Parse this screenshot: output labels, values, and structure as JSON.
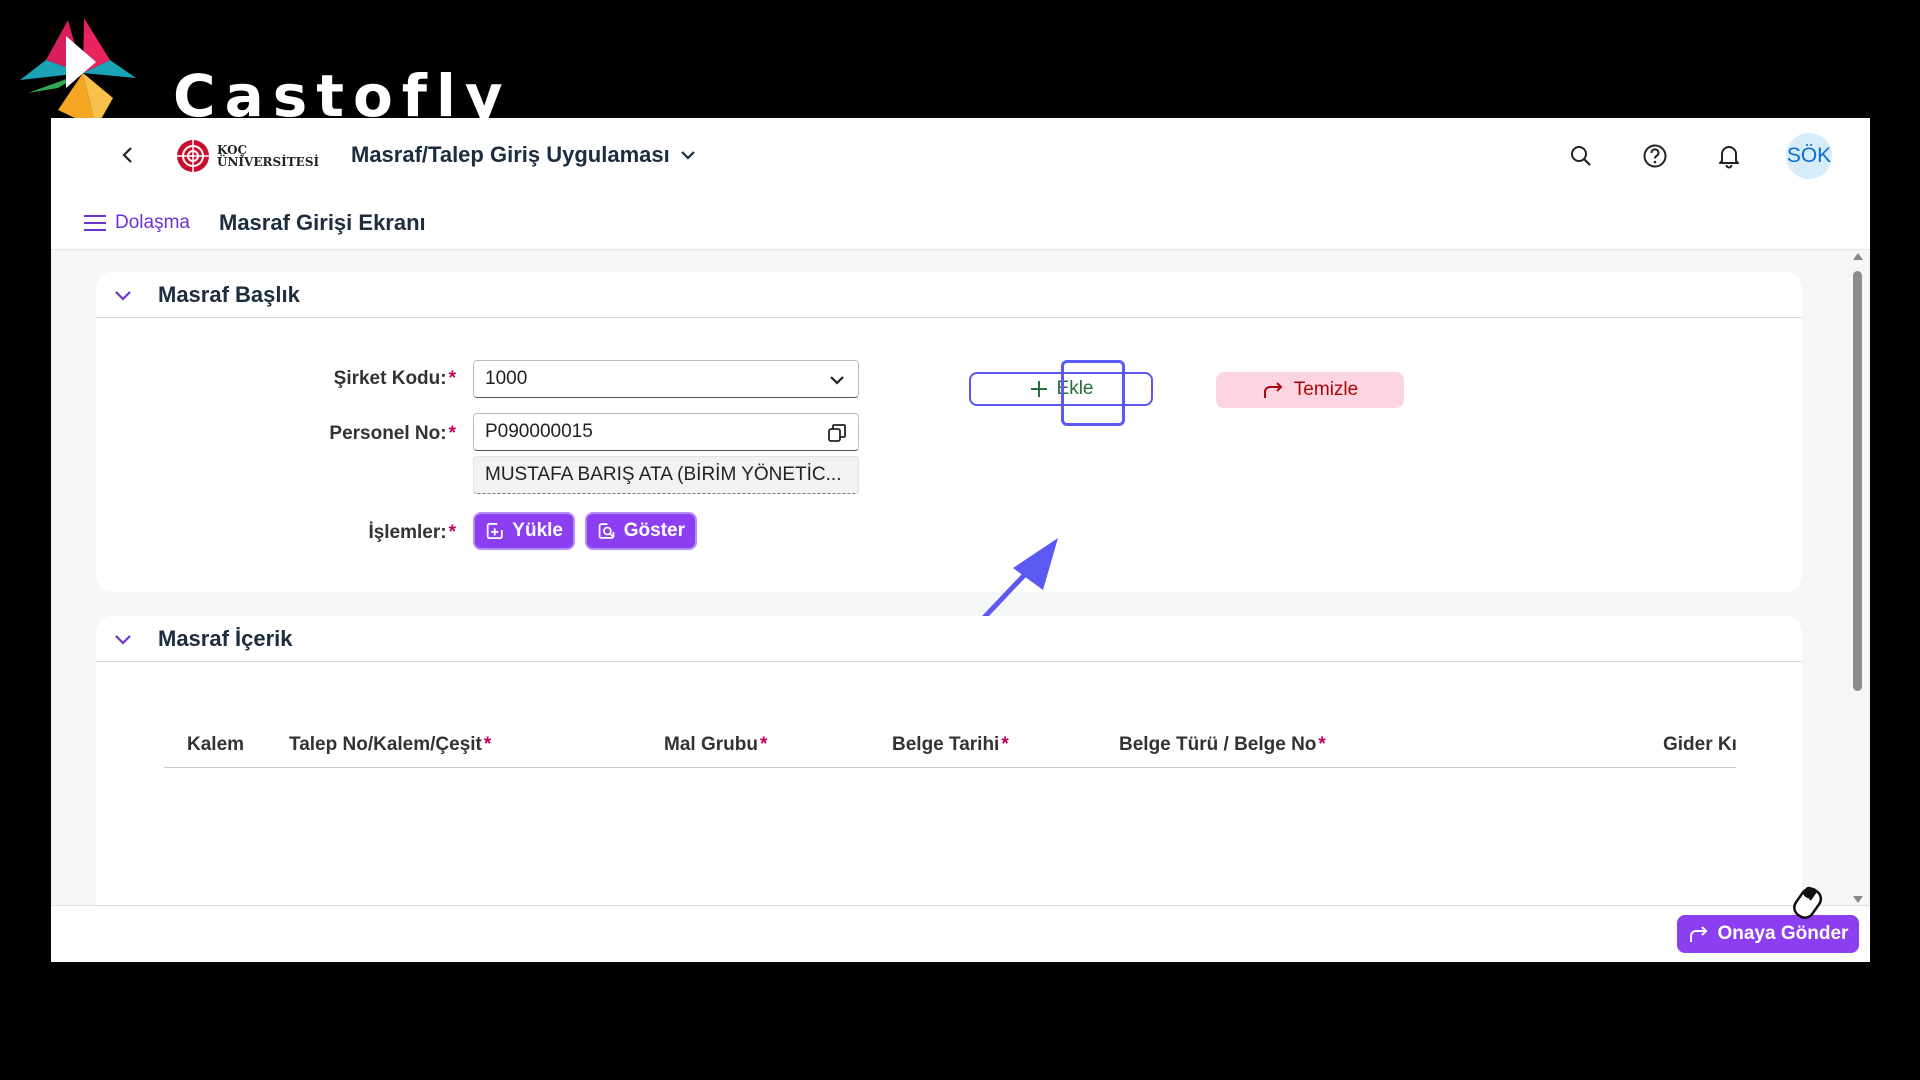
{
  "watermark": {
    "brand": "Castofly"
  },
  "shellbar": {
    "logo_line1": "KOÇ",
    "logo_line2": "ÜNİVERSİTESİ",
    "app_title": "Masraf/Talep Giriş Uygulaması",
    "avatar_initials": "SÖK"
  },
  "subheader": {
    "nav_label": "Dolaşma",
    "page_title": "Masraf Girişi Ekranı"
  },
  "header_panel": {
    "title": "Masraf Başlık",
    "company_code_label": "Şirket Kodu:",
    "company_code_value": "1000",
    "personnel_no_label": "Personel No:",
    "personnel_no_value": "P090000015",
    "personnel_name": "MUSTAFA BARIŞ  ATA (BİRİM YÖNETİC...",
    "operations_label": "İşlemler:",
    "upload_button": "Yükle",
    "show_button": "Göster",
    "add_button": "Ekle",
    "clear_button": "Temizle",
    "required_mark": "*"
  },
  "content_panel": {
    "title": "Masraf İçerik",
    "columns": [
      {
        "label": "Kalem",
        "required": ""
      },
      {
        "label": "Talep No/Kalem/Çeşit",
        "required": "*"
      },
      {
        "label": "Mal Grubu",
        "required": "*"
      },
      {
        "label": "Belge Tarihi",
        "required": "*"
      },
      {
        "label": "Belge Türü / Belge No",
        "required": "*"
      },
      {
        "label": "Gider Kı",
        "required": ""
      }
    ]
  },
  "footer": {
    "submit_button": "Onaya Gönder"
  },
  "colors": {
    "accent": "#8c3ef1",
    "annotation": "#5b59f1",
    "clear_bg": "#fdd5e2",
    "clear_text": "#aa0808"
  }
}
